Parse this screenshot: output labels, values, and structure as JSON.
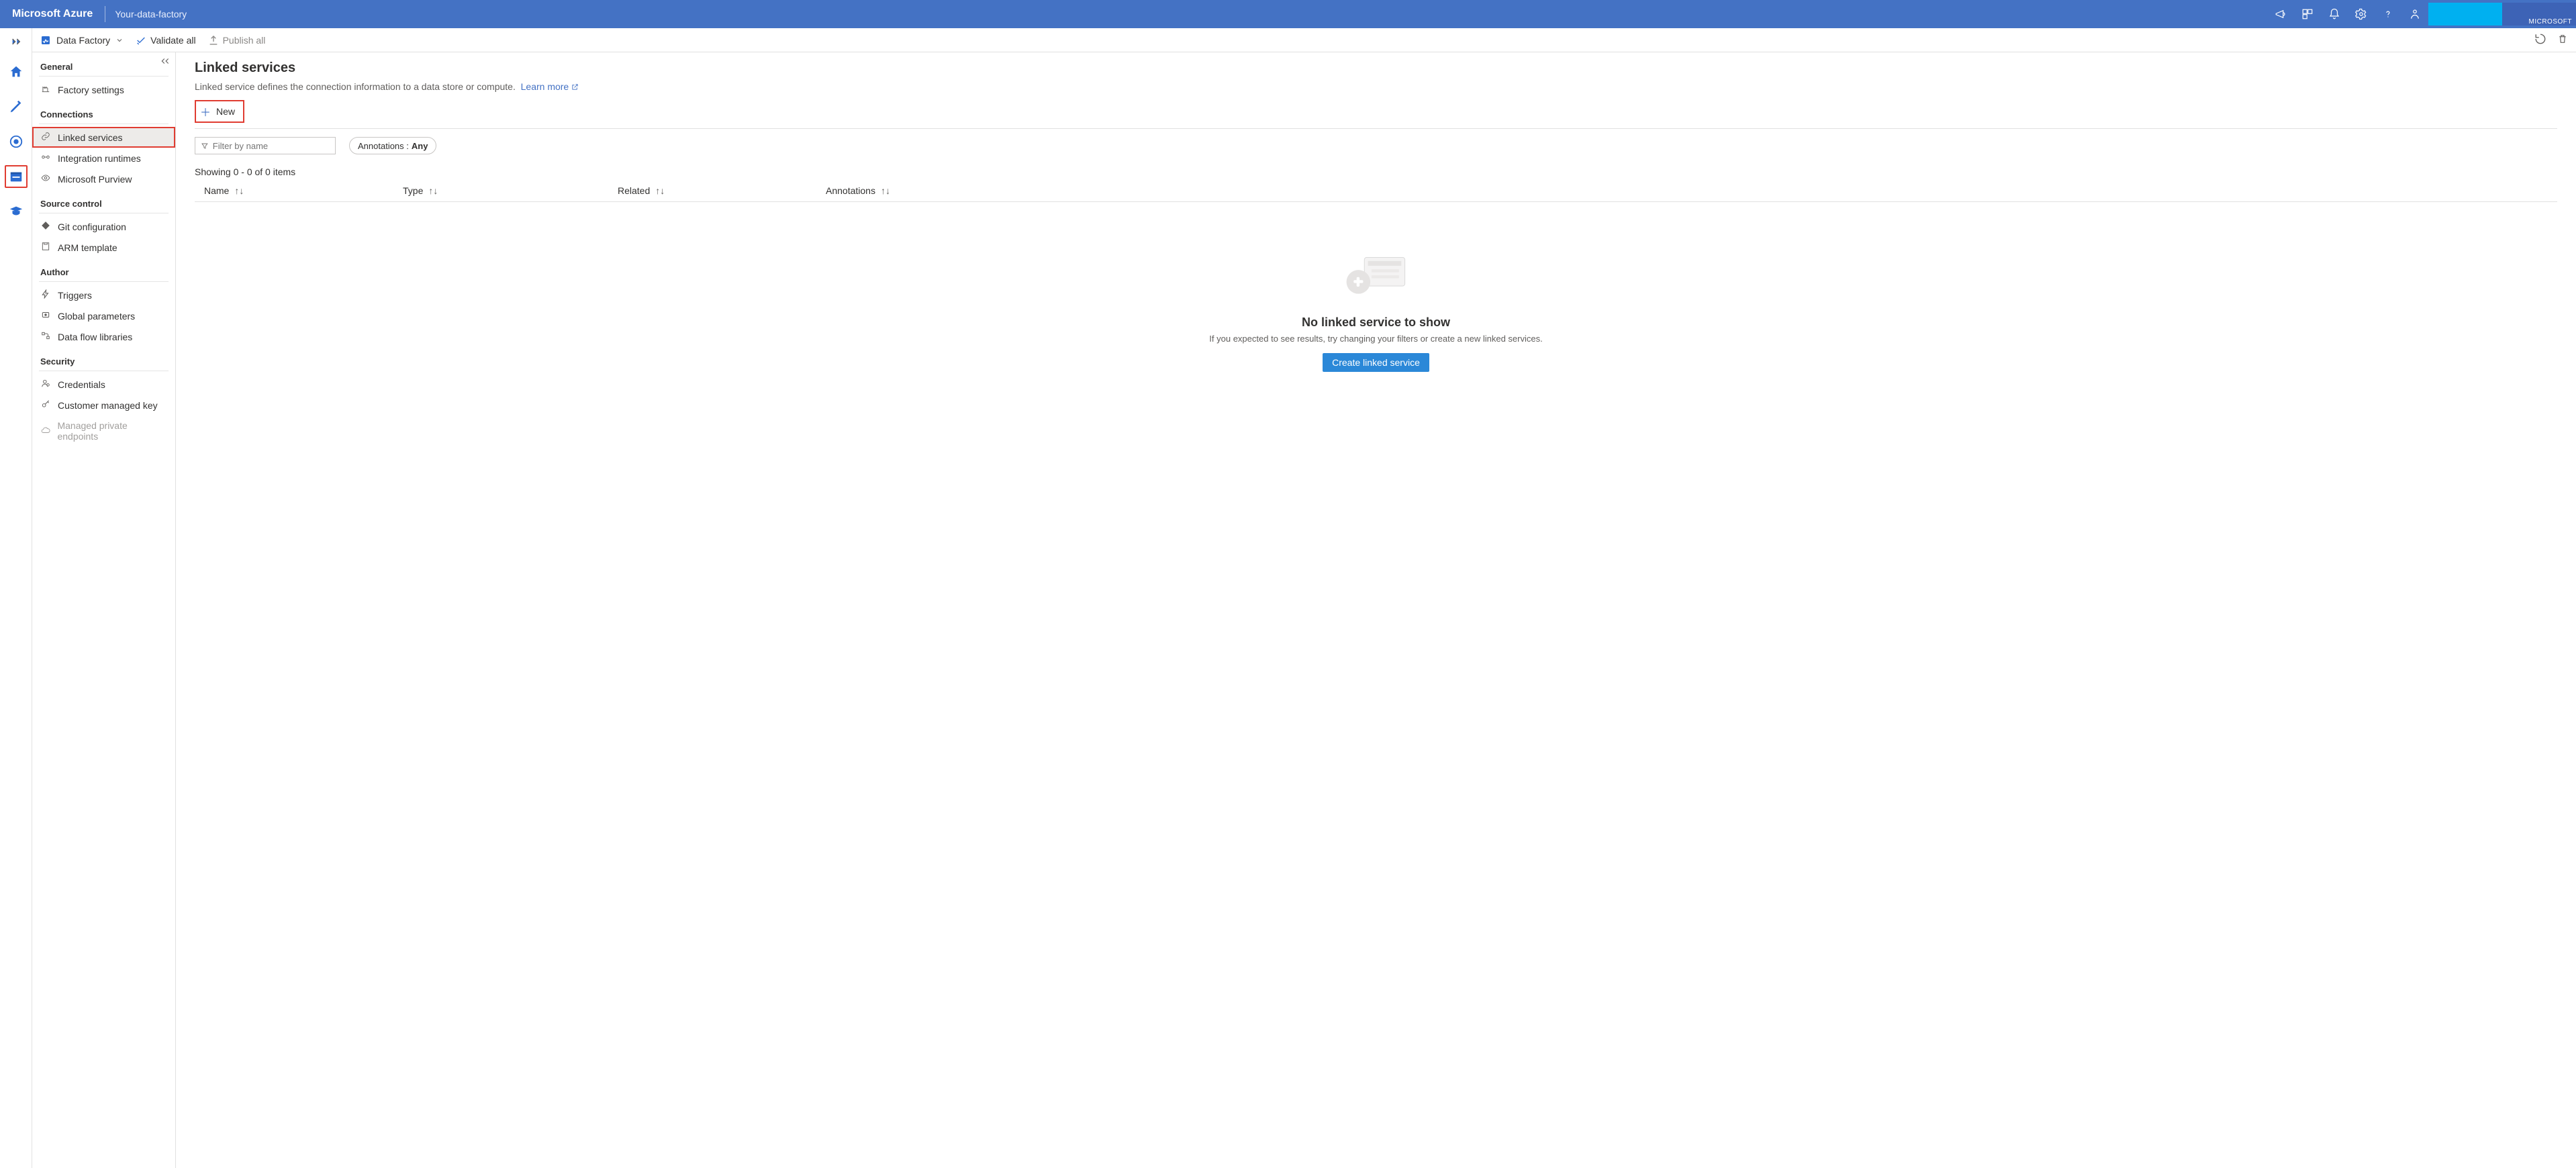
{
  "topbar": {
    "brand": "Microsoft Azure",
    "crumb": "Your-data-factory",
    "swatch_label": "MICROSOFT"
  },
  "rail": {
    "expand_title": "Expand"
  },
  "crumbbar": {
    "root": "Data Factory",
    "validate": "Validate all",
    "publish": "Publish all"
  },
  "nav": {
    "sections": {
      "general": {
        "title": "General",
        "items": [
          {
            "label": "Factory settings"
          }
        ]
      },
      "connections": {
        "title": "Connections",
        "items": [
          {
            "label": "Linked services",
            "active": true
          },
          {
            "label": "Integration runtimes"
          },
          {
            "label": "Microsoft Purview"
          }
        ]
      },
      "source": {
        "title": "Source control",
        "items": [
          {
            "label": "Git configuration"
          },
          {
            "label": "ARM template"
          }
        ]
      },
      "author": {
        "title": "Author",
        "items": [
          {
            "label": "Triggers"
          },
          {
            "label": "Global parameters"
          },
          {
            "label": "Data flow libraries"
          }
        ]
      },
      "security": {
        "title": "Security",
        "items": [
          {
            "label": "Credentials"
          },
          {
            "label": "Customer managed key"
          },
          {
            "label": "Managed private endpoints",
            "disabled": true
          }
        ]
      }
    }
  },
  "page": {
    "title": "Linked services",
    "subtitle_text": "Linked service defines the connection information to a data store or compute.",
    "learn_more": "Learn more",
    "new_button": "New",
    "filter_placeholder": "Filter by name",
    "annotations_label": "Annotations :",
    "annotations_value": "Any",
    "count_text": "Showing 0 - 0 of 0 items",
    "columns": {
      "name": "Name",
      "type": "Type",
      "related": "Related",
      "annotations": "Annotations"
    },
    "empty": {
      "title": "No linked service to show",
      "desc": "If you expected to see results, try changing your filters or create a new linked services.",
      "button": "Create linked service"
    }
  }
}
